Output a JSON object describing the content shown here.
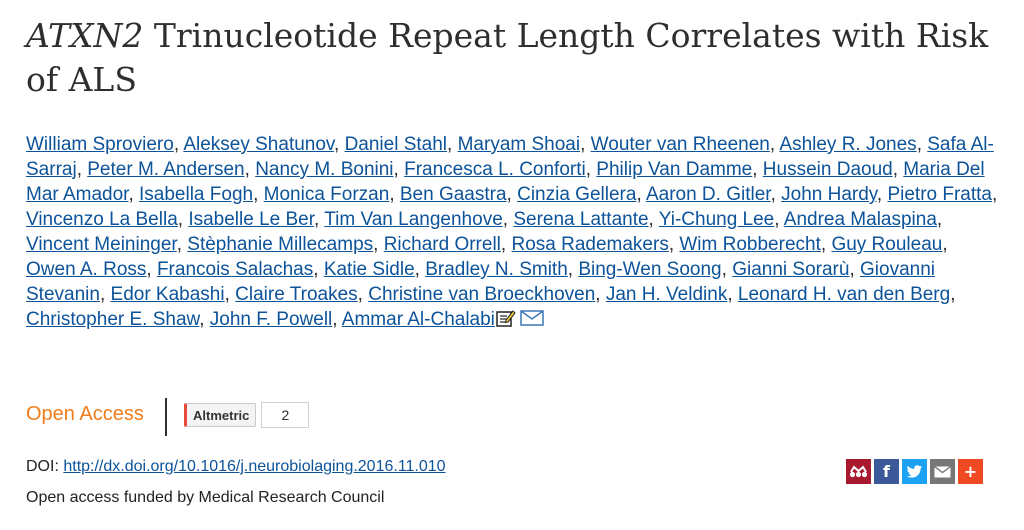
{
  "article": {
    "title_gene": "ATXN2",
    "title_rest": " Trinucleotide Repeat Length Correlates with Risk of ALS",
    "authors": [
      "William Sproviero",
      "Aleksey Shatunov",
      "Daniel Stahl",
      "Maryam Shoai",
      "Wouter van Rheenen",
      "Ashley R. Jones",
      "Safa Al-Sarraj",
      "Peter M. Andersen",
      "Nancy M. Bonini",
      "Francesca L. Conforti",
      "Philip Van Damme",
      "Hussein Daoud",
      "Maria Del Mar Amador",
      "Isabella Fogh",
      "Monica Forzan",
      "Ben Gaastra",
      "Cinzia Gellera",
      "Aaron D. Gitler",
      "John Hardy",
      "Pietro Fratta",
      "Vincenzo La Bella",
      "Isabelle Le Ber",
      "Tim Van Langenhove",
      "Serena Lattante",
      "Yi-Chung Lee",
      "Andrea Malaspina",
      "Vincent Meininger",
      "Stèphanie Millecamps",
      "Richard Orrell",
      "Rosa Rademakers",
      "Wim Robberecht",
      "Guy Rouleau",
      "Owen A. Ross",
      "Francois Salachas",
      "Katie Sidle",
      "Bradley N. Smith",
      "Bing-Wen Soong",
      "Gianni Sorarù",
      "Giovanni Stevanin",
      "Edor Kabashi",
      "Claire Troakes",
      "Christine van Broeckhoven",
      "Jan H. Veldink",
      "Leonard H. van den Berg",
      "Christopher E. Shaw",
      "John F. Powell",
      "Ammar Al-Chalabi"
    ],
    "open_access_label": "Open Access",
    "altmetric": {
      "label": "Altmetric",
      "count": "2"
    },
    "doi_label": "DOI: ",
    "doi_url": "http://dx.doi.org/10.1016/j.neurobiolaging.2016.11.010",
    "funding": "Open access funded by Medical Research Council"
  },
  "share_icons": [
    {
      "name": "mendeley-share-icon",
      "color": "#a6192e",
      "glyph": ""
    },
    {
      "name": "facebook-share-icon",
      "color": "#3b5998",
      "glyph": "f"
    },
    {
      "name": "twitter-share-icon",
      "color": "#1da1f2",
      "glyph": ""
    },
    {
      "name": "email-share-icon",
      "color": "#777777",
      "glyph": ""
    },
    {
      "name": "more-share-icon",
      "color": "#f04a25",
      "glyph": "+"
    }
  ]
}
